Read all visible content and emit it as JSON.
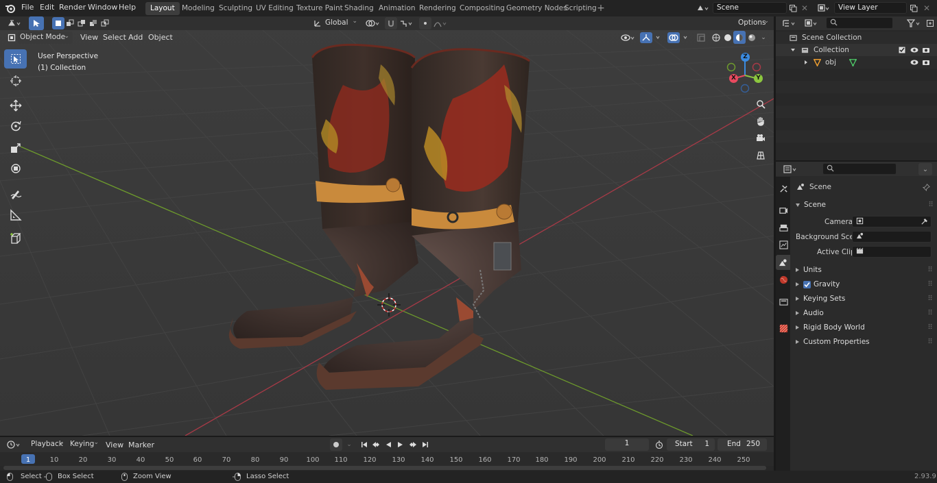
{
  "menu": [
    "File",
    "Edit",
    "Render",
    "Window",
    "Help"
  ],
  "workspaces": [
    "Layout",
    "Modeling",
    "Sculpting",
    "UV Editing",
    "Texture Paint",
    "Shading",
    "Animation",
    "Rendering",
    "Compositing",
    "Geometry Nodes",
    "Scripting"
  ],
  "active_workspace": "Layout",
  "scene_name": "Scene",
  "view_layer": "View Layer",
  "viewport": {
    "mode": "Object Mode",
    "menus": [
      "View",
      "Select",
      "Add",
      "Object"
    ],
    "orientation": "Global",
    "options": "Options",
    "perspective": "User Perspective",
    "collection": "(1) Collection",
    "gizmo_labels": {
      "z": "Z",
      "y": "Y",
      "x": "X"
    }
  },
  "outliner": {
    "scene_collection": "Scene Collection",
    "collection": "Collection",
    "object": "obj"
  },
  "properties": {
    "context": "Scene",
    "panel": "Scene",
    "camera_label": "Camera",
    "bg_scene_label": "Background Scene",
    "active_clip_label": "Active Clip",
    "sections": [
      "Units",
      "Gravity",
      "Keying Sets",
      "Audio",
      "Rigid Body World",
      "Custom Properties"
    ]
  },
  "timeline": {
    "menus": [
      "Playback",
      "Keying",
      "View",
      "Marker"
    ],
    "current_frame": "1",
    "start_label": "Start",
    "start": "1",
    "end_label": "End",
    "end": "250",
    "ruler": [
      "1",
      "10",
      "20",
      "30",
      "40",
      "50",
      "60",
      "70",
      "80",
      "90",
      "100",
      "110",
      "120",
      "130",
      "140",
      "150",
      "160",
      "170",
      "180",
      "190",
      "200",
      "210",
      "220",
      "230",
      "240",
      "250"
    ]
  },
  "status": {
    "items": [
      "Select",
      "Box Select",
      "Zoom View",
      "Lasso Select"
    ],
    "version": "2.93.9"
  },
  "colors": {
    "accent": "#4772b3",
    "axis_x": "#a83a47",
    "axis_y": "#6d9a2c",
    "gizmo_x": "#e84a5f",
    "gizmo_y": "#8cc63f",
    "gizmo_z": "#3b8be0"
  }
}
